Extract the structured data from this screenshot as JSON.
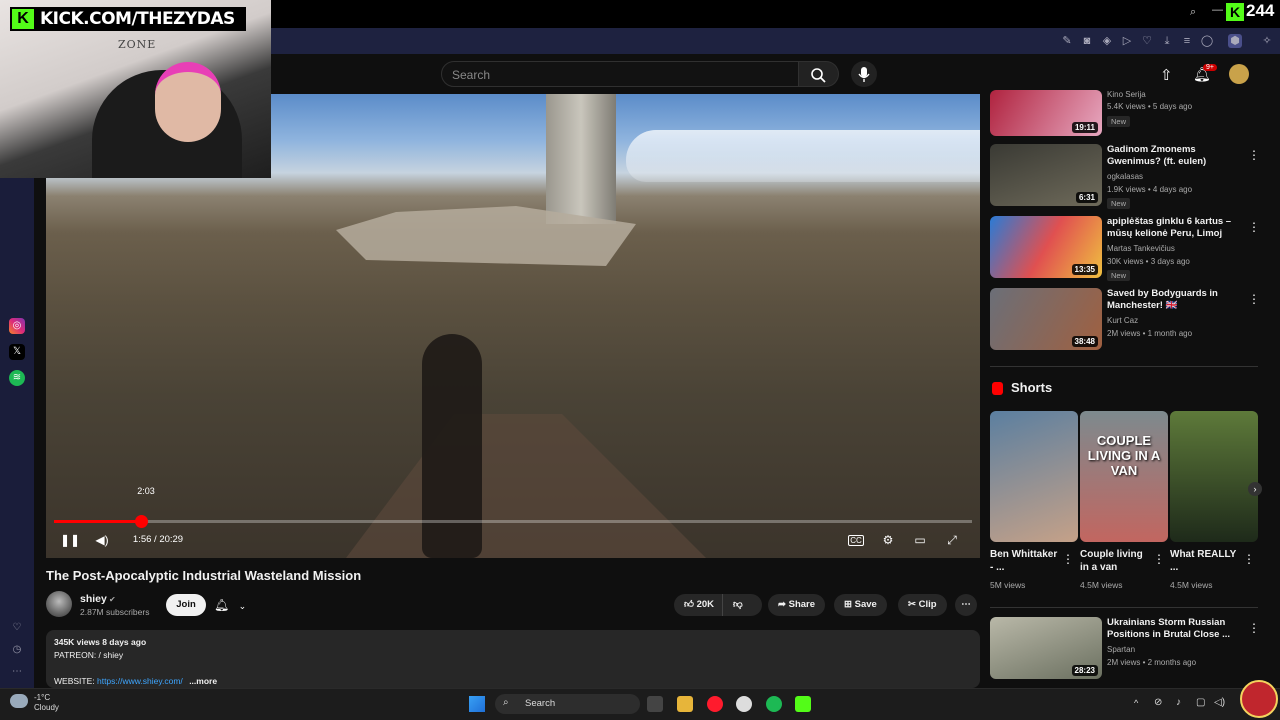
{
  "kick": {
    "handle": "KICK.COM/THEZYDAS",
    "viewer_count": "244",
    "logo_letter": "K",
    "wall_text": "ZONE"
  },
  "masthead": {
    "search_placeholder": "Search",
    "notif_badge": "9+"
  },
  "player": {
    "current_time": "1:56 / 20:29",
    "hover_time": "2:03",
    "progress": 0.095
  },
  "video": {
    "title": "The Post-Apocalyptic Industrial Wasteland Mission",
    "channel": "shiey",
    "subscribers": "2.87M subscribers",
    "join": "Join",
    "likes": "20K",
    "share": "Share",
    "save": "Save",
    "clip": "Clip",
    "description": {
      "meta": "345K views  8 days ago",
      "patreon": "PATREON:  / shiey",
      "website_label": "WEBSITE: ",
      "website_url": "https://www.shiey.com/",
      "more": "...more"
    }
  },
  "recommended": [
    {
      "title": "",
      "channel": "Kino Serija",
      "meta": "5.4K views • 5 days ago",
      "duration": "19:11",
      "badge": "New",
      "colors": [
        "#b0233f",
        "#e7a8c0"
      ]
    },
    {
      "title": "Gadinom Zmonems Gwenimus? (ft. eulen)",
      "channel": "ogkalasas",
      "meta": "1.9K views • 4 days ago",
      "duration": "6:31",
      "badge": "New",
      "colors": [
        "#3a3a34",
        "#6e6a5a"
      ]
    },
    {
      "title": "apiplėštas ginklu 6 kartus – mūsų kelionė Peru, Limoj",
      "channel": "Martas Tankevičius",
      "meta": "30K views • 3 days ago",
      "duration": "13:35",
      "badge": "New",
      "colors": [
        "#2a7bd6",
        "#e05050"
      ]
    },
    {
      "title": "Saved by Bodyguards in Manchester! 🇬🇧",
      "channel": "Kurt Caz",
      "meta": "2M views • 1 month ago",
      "duration": "38:48",
      "badge": "",
      "colors": [
        "#6b6f78",
        "#a06040"
      ]
    }
  ],
  "shorts": {
    "heading": "Shorts",
    "items": [
      {
        "title": "Ben Whittaker - ...",
        "views": "5M views",
        "overlay": "",
        "colors": [
          "#5b7fa0",
          "#c5a188"
        ]
      },
      {
        "title": "Couple living in a van",
        "views": "4.5M views",
        "overlay": "COUPLE LIVING IN A VAN",
        "colors": [
          "#7d8a8e",
          "#c26660"
        ]
      },
      {
        "title": "What REALLY ...",
        "views": "4.5M views",
        "overlay": "",
        "colors": [
          "#5e7a3a",
          "#1e2a1a"
        ]
      }
    ]
  },
  "recommended_bottom": {
    "title": "Ukrainians Storm Russian Positions in Brutal Close ...",
    "channel": "Spartan",
    "meta": "2M views • 2 months ago",
    "duration": "28:23",
    "colors": [
      "#6b7060",
      "#b9b8a8"
    ]
  },
  "taskbar": {
    "search": "Search",
    "weather_temp": "-1°C",
    "weather_desc": "Cloudy"
  }
}
